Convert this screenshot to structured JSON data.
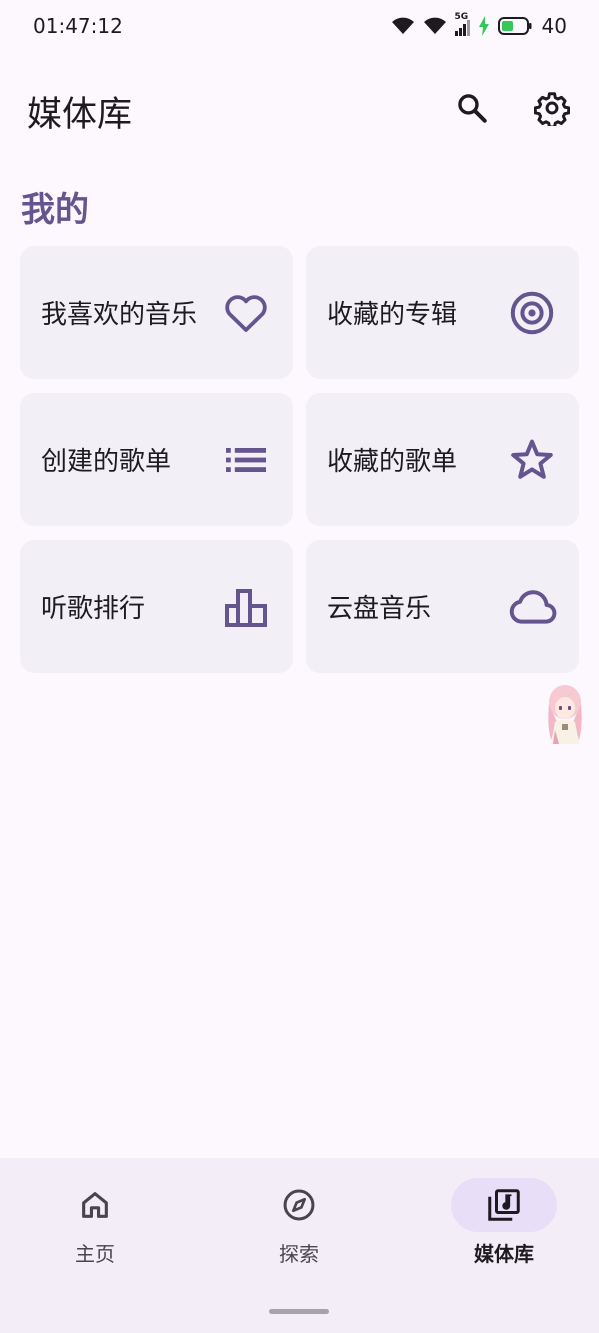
{
  "status_bar": {
    "time": "01:47:12",
    "network": "5G",
    "battery": "40",
    "charging_color": "#35c759"
  },
  "app_bar": {
    "title": "媒体库",
    "search_icon": "search-icon",
    "settings_icon": "gear-icon"
  },
  "section": {
    "title": "我的"
  },
  "cards": [
    {
      "label": "我喜欢的音乐",
      "icon": "heart-icon"
    },
    {
      "label": "收藏的专辑",
      "icon": "album-disc-icon"
    },
    {
      "label": "创建的歌单",
      "icon": "list-icon"
    },
    {
      "label": "收藏的歌单",
      "icon": "star-icon"
    },
    {
      "label": "听歌排行",
      "icon": "bar-chart-icon"
    },
    {
      "label": "云盘音乐",
      "icon": "cloud-icon"
    }
  ],
  "bottom_nav": {
    "items": [
      {
        "label": "主页",
        "icon": "home-icon",
        "active": false
      },
      {
        "label": "探索",
        "icon": "compass-icon",
        "active": false
      },
      {
        "label": "媒体库",
        "icon": "library-music-icon",
        "active": true
      }
    ]
  },
  "colors": {
    "accent": "#65558f",
    "card_bg": "#f2eff7",
    "background": "#fdf7fe",
    "nav_bg": "#f3edf7",
    "nav_active_bg": "#e8def8"
  }
}
